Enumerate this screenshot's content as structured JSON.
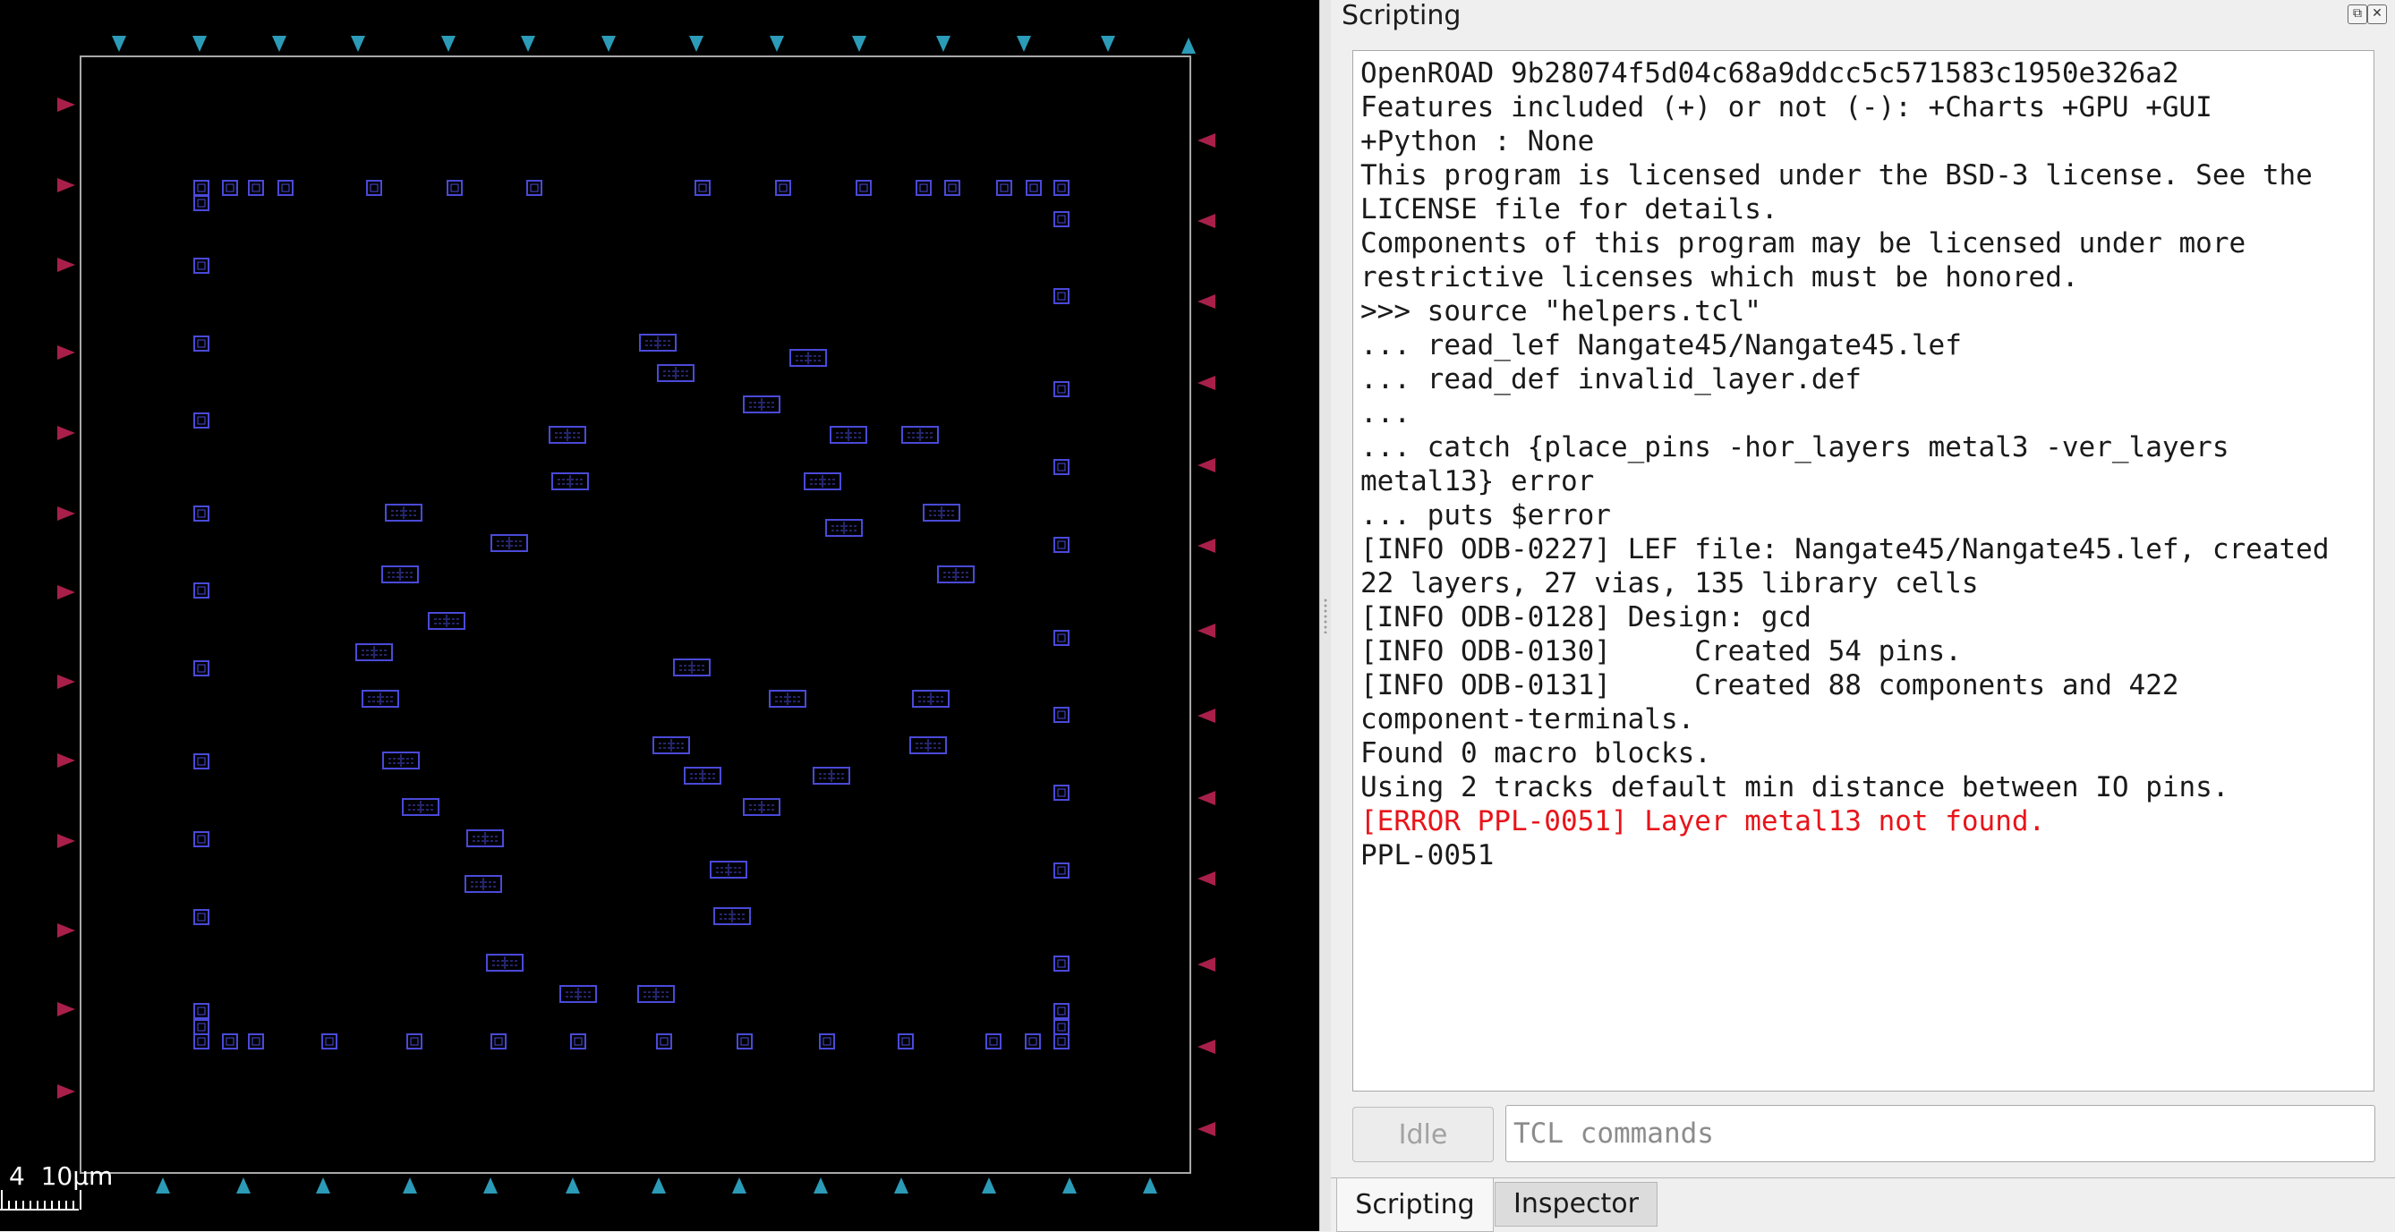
{
  "layout_view": {
    "scale_bar_label": "4  10µm",
    "colors": {
      "background": "#000000",
      "die_outline": "#a8a8a8",
      "cell_outline": "#4a4ad8",
      "pin_top_bottom": "#2b9bb8",
      "pin_left_right": "#a8204a"
    }
  },
  "dock": {
    "title": "Scripting",
    "float_icon": "float-icon",
    "close_icon": "close-icon",
    "console_lines": [
      {
        "text": "OpenROAD 9b28074f5d04c68a9ddcc5c571583c1950e326a2",
        "kind": "normal"
      },
      {
        "text": "Features included (+) or not (-): +Charts +GPU +GUI",
        "kind": "normal"
      },
      {
        "text": "+Python : None",
        "kind": "normal"
      },
      {
        "text": "This program is licensed under the BSD-3 license. See the",
        "kind": "normal"
      },
      {
        "text": "LICENSE file for details.",
        "kind": "normal"
      },
      {
        "text": "Components of this program may be licensed under more",
        "kind": "normal"
      },
      {
        "text": "restrictive licenses which must be honored.",
        "kind": "normal"
      },
      {
        "text": ">>> source \"helpers.tcl\"",
        "kind": "normal"
      },
      {
        "text": "... read_lef Nangate45/Nangate45.lef",
        "kind": "normal"
      },
      {
        "text": "... read_def invalid_layer.def",
        "kind": "normal"
      },
      {
        "text": "...",
        "kind": "normal"
      },
      {
        "text": "... catch {place_pins -hor_layers metal3 -ver_layers",
        "kind": "normal"
      },
      {
        "text": "metal13} error",
        "kind": "normal"
      },
      {
        "text": "... puts $error",
        "kind": "normal"
      },
      {
        "text": "[INFO ODB-0227] LEF file: Nangate45/Nangate45.lef, created",
        "kind": "normal"
      },
      {
        "text": "22 layers, 27 vias, 135 library cells",
        "kind": "normal"
      },
      {
        "text": "[INFO ODB-0128] Design: gcd",
        "kind": "normal"
      },
      {
        "text": "[INFO ODB-0130]     Created 54 pins.",
        "kind": "normal"
      },
      {
        "text": "[INFO ODB-0131]     Created 88 components and 422",
        "kind": "normal"
      },
      {
        "text": "component-terminals.",
        "kind": "normal"
      },
      {
        "text": "Found 0 macro blocks.",
        "kind": "normal"
      },
      {
        "text": "Using 2 tracks default min distance between IO pins.",
        "kind": "normal"
      },
      {
        "text": "[ERROR PPL-0051] Layer metal13 not found.",
        "kind": "error"
      },
      {
        "text": "PPL-0051",
        "kind": "normal"
      }
    ],
    "idle_button_label": "Idle",
    "command_input": {
      "value": "",
      "placeholder": "TCL commands"
    },
    "tabs": [
      {
        "label": "Scripting",
        "active": true
      },
      {
        "label": "Inspector",
        "active": false
      }
    ]
  }
}
